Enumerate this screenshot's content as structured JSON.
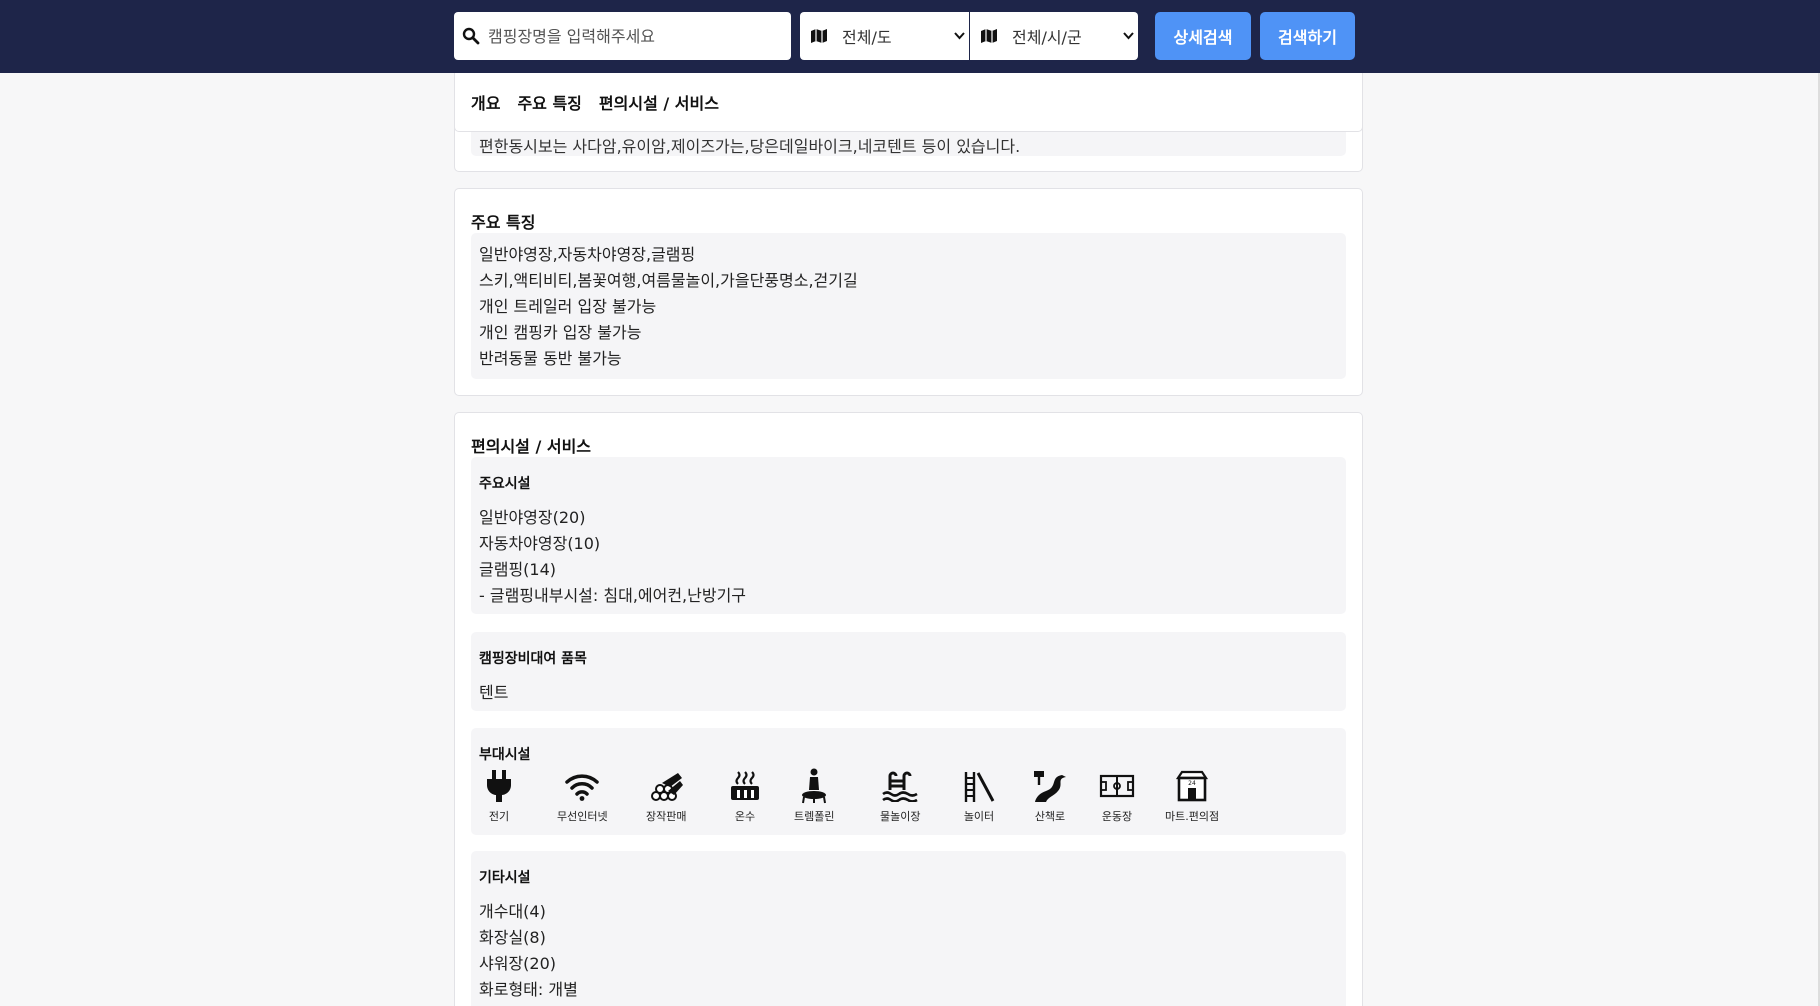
{
  "header": {
    "search_placeholder": "캠핑장명을 입력해주세요",
    "sido_value": "전체/도",
    "sigungu_value": "전체/시/군",
    "detail_search_label": "상세검색",
    "search_label": "검색하기"
  },
  "tabs": [
    {
      "label": "개요"
    },
    {
      "label": "주요 특징"
    },
    {
      "label": "편의시설 / 서비스"
    }
  ],
  "overview": {
    "partial_text": "편한동시보는 사다암,유이암,제이즈가는,당은데일바이크,네코텐트 등이 있습니다."
  },
  "features": {
    "title": "주요 특징",
    "lines": [
      "일반야영장,자동차야영장,글램핑",
      "스키,액티비티,봄꽃여행,여름물놀이,가을단풍명소,걷기길",
      "개인 트레일러 입장 불가능",
      "개인 캠핑카 입장 불가능",
      "반려동물 동반 불가능"
    ]
  },
  "amenities": {
    "title": "편의시설 / 서비스",
    "main_facilities": {
      "title": "주요시설",
      "lines": [
        "일반야영장(20)",
        "자동차야영장(10)",
        "글램핑(14)",
        "- 글램핑내부시설: 침대,에어컨,난방기구"
      ]
    },
    "rental": {
      "title": "캠핑장비대여 품목",
      "lines": [
        "텐트"
      ]
    },
    "sub_facilities": {
      "title": "부대시설",
      "items": [
        {
          "label": "전기",
          "icon": "plug-icon"
        },
        {
          "label": "무선인터넷",
          "icon": "wifi-icon"
        },
        {
          "label": "장작판매",
          "icon": "firewood-icon"
        },
        {
          "label": "온수",
          "icon": "hot-water-icon"
        },
        {
          "label": "트렘폴린",
          "icon": "trampoline-icon"
        },
        {
          "label": "물놀이장",
          "icon": "pool-icon"
        },
        {
          "label": "놀이터",
          "icon": "playground-icon"
        },
        {
          "label": "산책로",
          "icon": "trail-icon"
        },
        {
          "label": "운동장",
          "icon": "field-icon"
        },
        {
          "label": "마트.편의점",
          "icon": "store-icon"
        }
      ]
    },
    "other": {
      "title": "기타시설",
      "lines": [
        "개수대(4)",
        "화장실(8)",
        "샤워장(20)",
        "화로형태: 개별"
      ]
    }
  },
  "colors": {
    "header_bg": "#1e2549",
    "button_bg": "#4f93f6",
    "panel_bg": "#f5f5f7"
  }
}
